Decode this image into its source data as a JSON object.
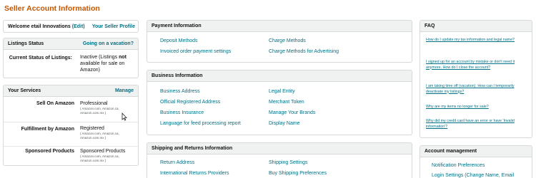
{
  "page": {
    "title": "Seller Account Information"
  },
  "welcome": {
    "text": "Welcome etail Innovations",
    "edit": "(Edit)",
    "profile_link": "Your Seller Profile"
  },
  "listings": {
    "header": "Listings Status",
    "vacation_link": "Going on a vacation?",
    "label": "Current Status of Listings:",
    "value_pre": "Inactive (Listings ",
    "value_bold": "not",
    "value_post": " available for sale on Amazon)"
  },
  "services": {
    "header": "Your Services",
    "manage": "Manage",
    "rows": [
      {
        "label": "Sell On Amazon",
        "value": "Professional",
        "sub": "( Amazon.com, Amazon.ca, Amazon.com.mx )"
      },
      {
        "label": "Fulfillment by Amazon",
        "value": "Registered",
        "sub": "( Amazon.com, Amazon.ca, Amazon.com.mx )"
      },
      {
        "label": "Sponsored Products",
        "value": "Sponsored Products",
        "sub": "( Amazon.com, Amazon.ca, Amazon.com.mx )"
      }
    ]
  },
  "payment": {
    "header": "Payment Information",
    "links": [
      "Deposit Methods",
      "Charge Methods",
      "Invoiced order payment settings",
      "Charge Methods for Advertising"
    ]
  },
  "business": {
    "header": "Business Information",
    "links": [
      "Business Address",
      "Legal Entity",
      "Official Registered Address",
      "Merchant Token",
      "Business Insurance",
      "Manage Your Brands",
      "Language for feed processing report",
      "Display Name"
    ]
  },
  "shipping": {
    "header": "Shipping and Returns Information",
    "links": [
      "Return Address",
      "Shipping Settings",
      "International Returns Providers",
      "Buy Shipping Preferences"
    ]
  },
  "faq": {
    "header": "FAQ",
    "items": [
      "How do I update my tax information and legal name?",
      "I signed up for an account by mistake or don't need it anymore. How do I close the account?",
      "I am taking time off (vacation). How can I temporarily deactivate my listings?",
      "Why are my items no longer for sale?",
      "Why did my credit card have an error or have 'Invalid information'?"
    ]
  },
  "account_mgmt": {
    "header": "Account management",
    "links": [
      "Notification Preferences",
      "Login Settings (Change Name, Email"
    ]
  }
}
